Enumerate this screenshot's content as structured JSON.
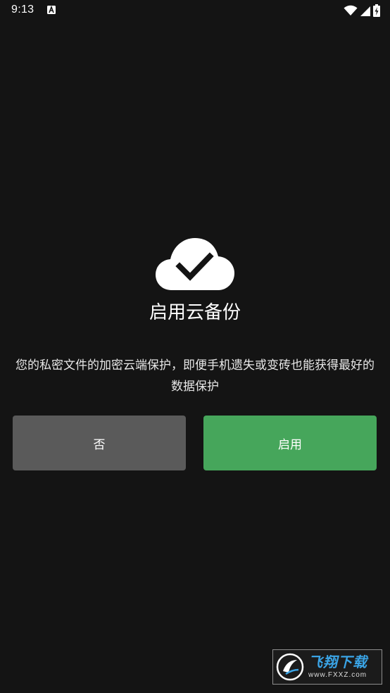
{
  "status_bar": {
    "time": "9:13",
    "icons": [
      "a-notification-icon",
      "wifi-icon",
      "cell-signal-icon",
      "battery-charging-icon"
    ]
  },
  "main": {
    "icon": "cloud-check-icon",
    "title": "启用云备份",
    "description": "您的私密文件的加密云端保护，即便手机遗失或变砖也能获得最好的数据保护"
  },
  "buttons": {
    "no_label": "否",
    "enable_label": "启用"
  },
  "watermark": {
    "main_text": "飞翔下载",
    "sub_text": "www.FXXZ.com"
  },
  "colors": {
    "background": "#141414",
    "no_button": "#5a5a5a",
    "enable_button": "#46a65b"
  }
}
